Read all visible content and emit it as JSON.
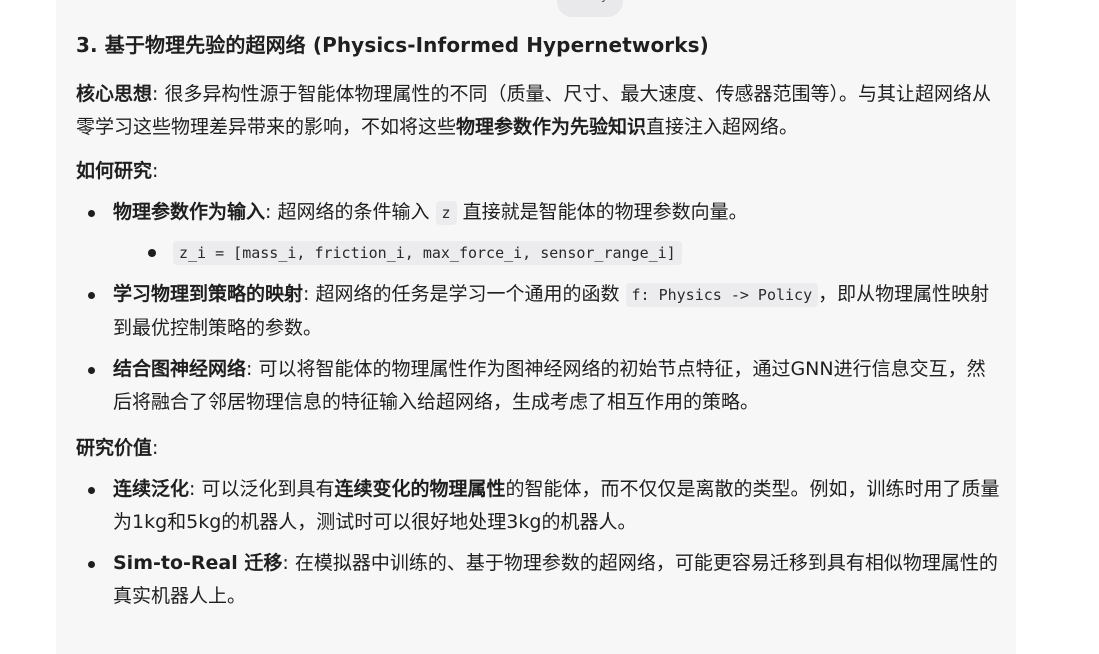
{
  "date_badge": "Today",
  "heading": "3. 基于物理先验的超网络 (Physics-Informed Hypernetworks)",
  "core": {
    "label": "核心思想",
    "text1": ": 很多异构性源于智能体物理属性的不同（质量、尺寸、最大速度、传感器范围等）。与其让超网络从零学习这些物理差异带来的影响，不如将这些",
    "bold": "物理参数作为先验知识",
    "text2": "直接注入超网络。"
  },
  "how": {
    "label": "如何研究",
    "colon": ":",
    "items": [
      {
        "bold": "物理参数作为输入",
        "text1": ": 超网络的条件输入 ",
        "code": "z",
        "text2": " 直接就是智能体的物理参数向量。",
        "sub_code": "z_i = [mass_i, friction_i, max_force_i, sensor_range_i]"
      },
      {
        "bold": "学习物理到策略的映射",
        "text1": ": 超网络的任务是学习一个通用的函数 ",
        "code": "f: Physics -> Policy",
        "text2": "，即从物理属性映射到最优控制策略的参数。"
      },
      {
        "bold": "结合图神经网络",
        "text1": ": 可以将智能体的物理属性作为图神经网络的初始节点特征，通过GNN进行信息交互，然后将融合了邻居物理信息的特征输入给超网络，生成考虑了相互作用的策略。"
      }
    ]
  },
  "value": {
    "label": "研究价值",
    "colon": ":",
    "items": [
      {
        "bold": "连续泛化",
        "text1": ": 可以泛化到具有",
        "bold2": "连续变化的物理属性",
        "text2": "的智能体，而不仅仅是离散的类型。例如，训练时用了质量为1kg和5kg的机器人，测试时可以很好地处理3kg的机器人。"
      },
      {
        "bold": "Sim-to-Real 迁移",
        "text1": ": 在模拟器中训练的、基于物理参数的超网络，可能更容易迁移到具有相似物理属性的真实机器人上。"
      }
    ]
  }
}
